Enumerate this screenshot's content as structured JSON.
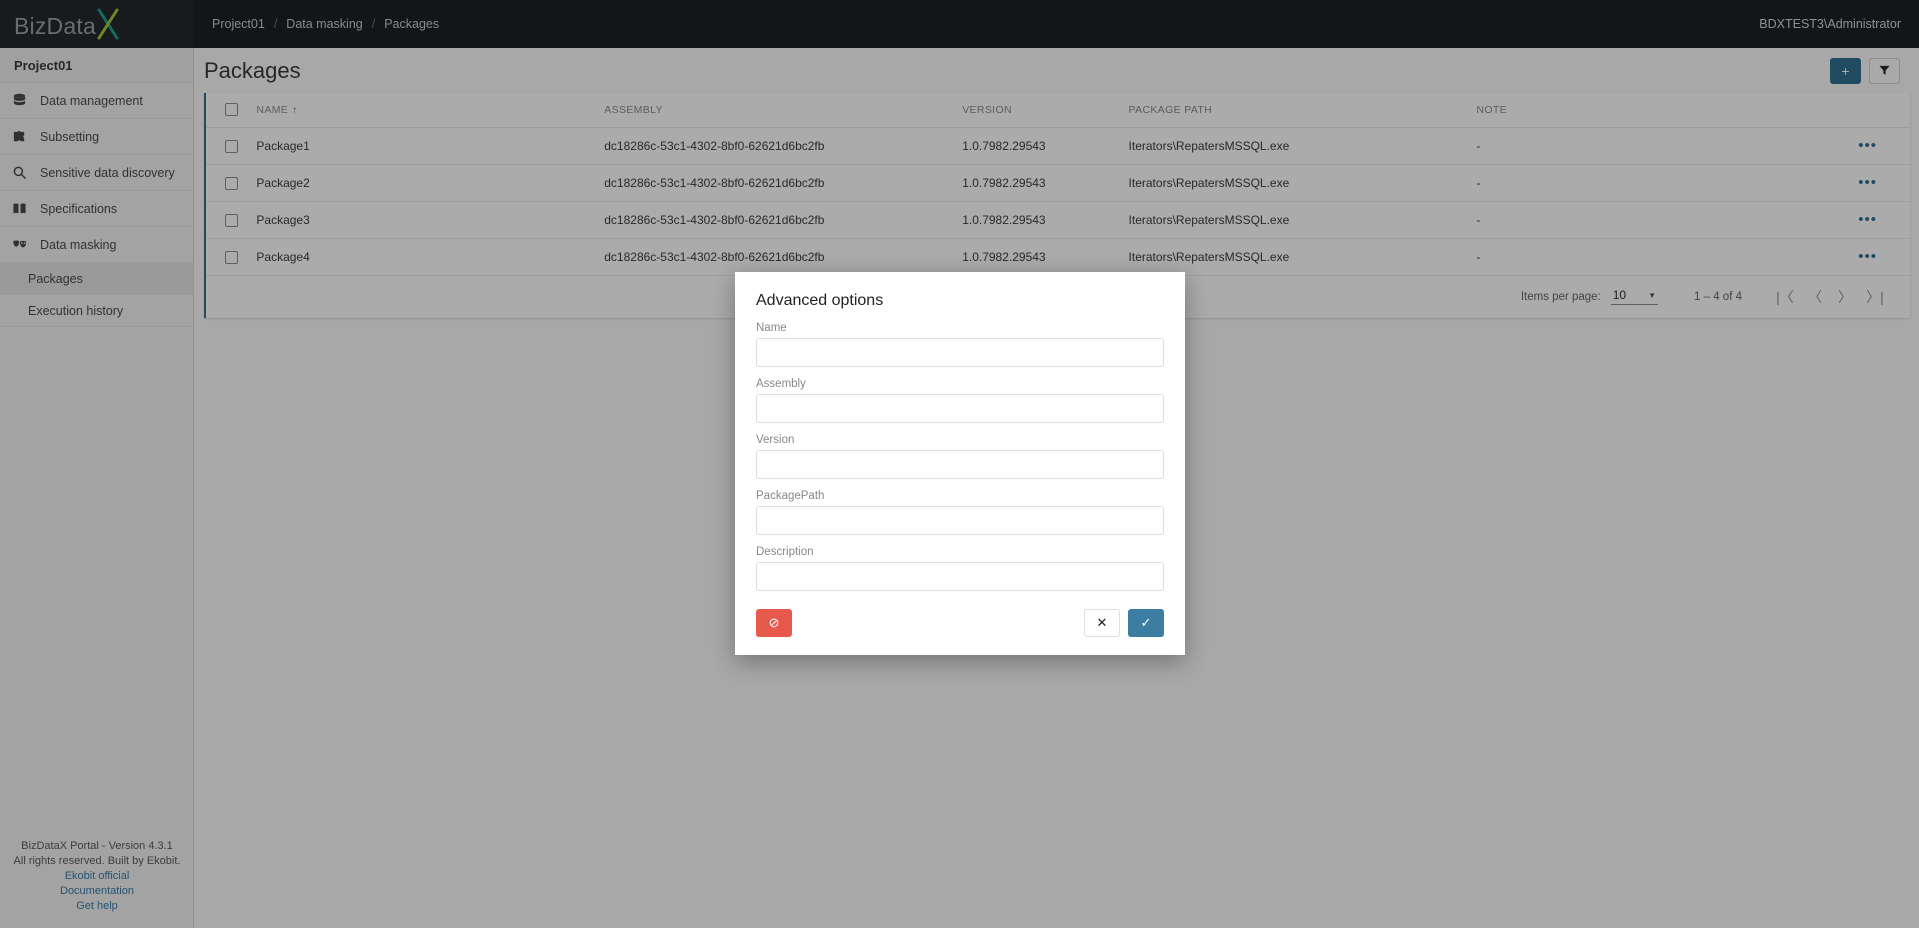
{
  "topbar": {
    "logo_main": "BizData",
    "logo_x": "X",
    "breadcrumb": [
      {
        "label": "Project01"
      },
      {
        "label": "Data masking"
      },
      {
        "label": "Packages"
      }
    ],
    "separator": "/",
    "user": "BDXTEST3\\Administrator"
  },
  "sidebar": {
    "project": "Project01",
    "items": [
      {
        "label": "Data management",
        "icon": "database-icon"
      },
      {
        "label": "Subsetting",
        "icon": "puzzle-piece-icon"
      },
      {
        "label": "Sensitive data discovery",
        "icon": "magnifier-icon"
      },
      {
        "label": "Specifications",
        "icon": "open-book-icon"
      },
      {
        "label": "Data masking",
        "icon": "theater-masks-icon"
      }
    ],
    "subitems": [
      {
        "label": "Packages",
        "active": true
      },
      {
        "label": "Execution history",
        "active": false
      }
    ],
    "footer": {
      "version_line": "BizDataX Portal - Version 4.3.1",
      "rights_line": "All rights reserved. Built by Ekobit.",
      "links": [
        {
          "label": "Ekobit official"
        },
        {
          "label": "Documentation"
        },
        {
          "label": "Get help"
        }
      ]
    }
  },
  "main": {
    "page_title": "Packages",
    "actions": {
      "add_label": "+",
      "filter_label": "▼"
    },
    "table": {
      "columns": [
        "NAME",
        "ASSEMBLY",
        "VERSION",
        "PACKAGE PATH",
        "NOTE"
      ],
      "sort_column": "NAME",
      "sort_arrow": "↑",
      "row_menu_glyph": "•••",
      "rows": [
        {
          "name": "Package1",
          "assembly": "dc18286c-53c1-4302-8bf0-62621d6bc2fb",
          "version": "1.0.7982.29543",
          "package_path": "Iterators\\RepatersMSSQL.exe",
          "note": "-"
        },
        {
          "name": "Package2",
          "assembly": "dc18286c-53c1-4302-8bf0-62621d6bc2fb",
          "version": "1.0.7982.29543",
          "package_path": "Iterators\\RepatersMSSQL.exe",
          "note": "-"
        },
        {
          "name": "Package3",
          "assembly": "dc18286c-53c1-4302-8bf0-62621d6bc2fb",
          "version": "1.0.7982.29543",
          "package_path": "Iterators\\RepatersMSSQL.exe",
          "note": "-"
        },
        {
          "name": "Package4",
          "assembly": "dc18286c-53c1-4302-8bf0-62621d6bc2fb",
          "version": "1.0.7982.29543",
          "package_path": "Iterators\\RepatersMSSQL.exe",
          "note": "-"
        }
      ]
    },
    "paginator": {
      "items_per_page_label": "Items per page:",
      "items_per_page_value": "10",
      "caret": "▼",
      "range_label": "1 – 4 of 4",
      "first_label": "|〈",
      "prev_label": "〈",
      "next_label": "〉",
      "last_label": "〉|"
    }
  },
  "modal": {
    "title": "Advanced options",
    "fields": [
      {
        "label": "Name",
        "value": "",
        "placeholder": ""
      },
      {
        "label": "Assembly",
        "value": "",
        "placeholder": ""
      },
      {
        "label": "Version",
        "value": "",
        "placeholder": ""
      },
      {
        "label": "PackagePath",
        "value": "",
        "placeholder": ""
      },
      {
        "label": "Description",
        "value": "",
        "placeholder": ""
      }
    ],
    "buttons": {
      "clear_label": "⊘",
      "cancel_label": "✕",
      "confirm_label": "✓"
    }
  },
  "colors": {
    "topbar_bg": "#1d2024",
    "accent_blue": "#31708f",
    "danger_red": "#e8594d",
    "link_blue": "#3a7ca8",
    "logo_teal": "#1b9e8f",
    "logo_green": "#a8c83c"
  }
}
